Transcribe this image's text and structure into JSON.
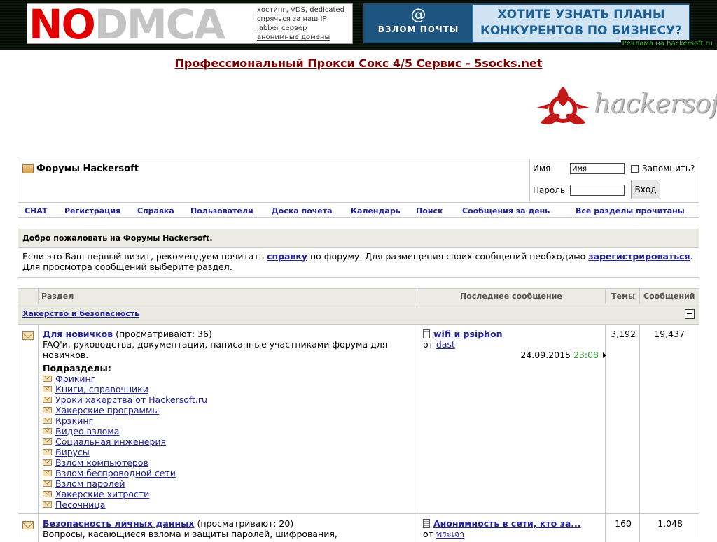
{
  "ads": {
    "nodmca": {
      "logo_no": "NO",
      "logo_dmca": "DMCA",
      "links": [
        "хостинг, VDS, dedicated",
        "спрячься за наш IP",
        "jabber сервер",
        "анонимные домены"
      ]
    },
    "mail": {
      "left_symbol": "@",
      "left_caption": "ВЗЛОМ ПОЧТЫ",
      "right_line1": "ХОТИТЕ УЗНАТЬ ПЛАНЫ",
      "right_line2": "КОНКУРЕНТОВ ПО БИЗНЕСУ?"
    },
    "note": "Реклама на hackersoft.ru"
  },
  "proxy_link": "Профессиональный Прокси Сокс 4/5 Сервис - 5socks.net",
  "site_logo": "hackersoft",
  "navbar": {
    "title": "Форумы Hackersoft",
    "login": {
      "name_label": "Имя",
      "name_value": "Имя",
      "password_label": "Пароль",
      "remember_label": "Запомнить?",
      "submit_label": "Вход"
    },
    "links": [
      "CHAT",
      "Регистрация",
      "Справка",
      "Пользователи",
      "Доска почета",
      "Календарь",
      "Поиск",
      "Сообщения за день",
      "Все разделы прочитаны"
    ]
  },
  "welcome": {
    "heading": "Добро пожаловать на Форумы Hackersoft.",
    "text1": "Если это Ваш первый визит, рекомендуем почитать ",
    "link_help": "справку",
    "text2": " по форуму. Для размещения своих сообщений необходимо ",
    "link_register": "зарегистрироваться",
    "text3": ". Для просмотра сообщений выберите раздел."
  },
  "table": {
    "headers": {
      "section": "Раздел",
      "last_post": "Последнее сообщение",
      "threads": "Темы",
      "posts": "Сообщений"
    },
    "category": "Хакерство и безопасность",
    "forums": [
      {
        "name": "Для новичков",
        "viewing": "(просматривают: 36)",
        "description": "FAQ'и, руководства, документации, написанные участниками форума для новичков.",
        "subforums_label": "Подразделы",
        "subforums": [
          "Фрикинг",
          "Книги, справочники",
          "Уроки хакерства от Hackersoft.ru",
          "Хакерские программы",
          "Крэкинг",
          "Видео взлома",
          "Социальная инженерия",
          "Вирусы",
          "Взлом компьютеров",
          "Взлом беспроводной сети",
          "Взлом паролей",
          "Хакерские хитрости",
          "Песочница"
        ],
        "last_title": "wifi и psiphon",
        "last_by_prefix": "от",
        "last_user": "dast",
        "last_date": "24.09.2015",
        "last_time": "23:08",
        "threads": "3,192",
        "posts": "19,437"
      },
      {
        "name": "Безопасность личных данных",
        "viewing": "(просматривают: 20)",
        "description": "Вопросы, касающиеся взлома и защиты паролей, шифрования,",
        "last_title": "Анонимность в сети, кто за...",
        "last_by_prefix": "от",
        "last_user": "พระเจา",
        "threads": "160",
        "posts": "1,048"
      }
    ]
  }
}
